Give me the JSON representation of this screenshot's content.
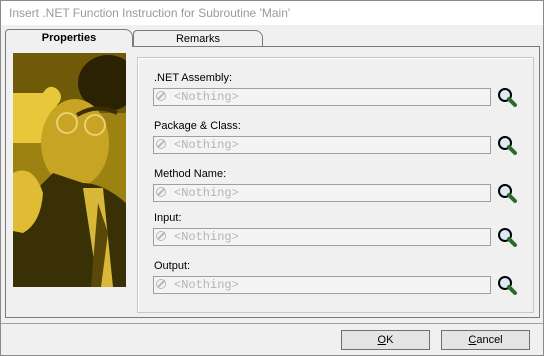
{
  "window": {
    "title": "Insert .NET Function Instruction for Subroutine 'Main'"
  },
  "tabs": [
    {
      "label": "Properties",
      "active": true
    },
    {
      "label": "Remarks",
      "active": false
    }
  ],
  "fields": [
    {
      "label": ".NET Assembly:",
      "value": "<Nothing>"
    },
    {
      "label": "Package & Class:",
      "value": "<Nothing>"
    },
    {
      "label": "Method Name:",
      "value": "<Nothing>"
    },
    {
      "label": "Input:",
      "value": "<Nothing>"
    },
    {
      "label": "Output:",
      "value": "<Nothing>"
    }
  ],
  "buttons": {
    "ok_accel": "O",
    "ok_rest": "K",
    "cancel_accel": "C",
    "cancel_rest": "ancel"
  },
  "icons": {
    "browse": "magnifier-icon",
    "field_empty": "no-entry-icon"
  },
  "colors": {
    "photo_tint": "#b09418",
    "placeholder": "#b4b4b4"
  }
}
